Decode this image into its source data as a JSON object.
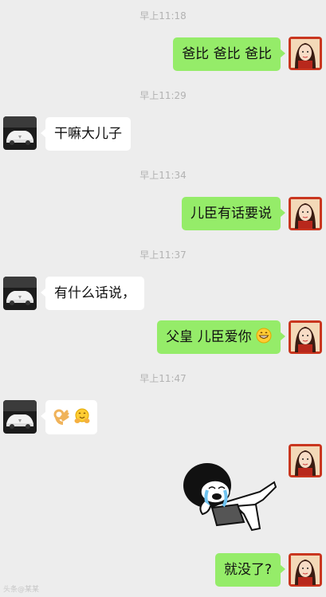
{
  "messages": [
    {
      "time": "早上11:18",
      "side": "out",
      "text": "爸比 爸比  爸比"
    },
    {
      "time": "早上11:29",
      "side": "in",
      "text": "干嘛大儿子"
    },
    {
      "time": "早上11:34",
      "side": "out",
      "text": "儿臣有话要说"
    },
    {
      "time": "早上11:37",
      "side": "in",
      "text": "有什么话说，"
    },
    {
      "side": "out",
      "text": "父皇 儿臣爱你",
      "emoji": "grinning-face-icon"
    },
    {
      "time": "早上11:47",
      "side": "in",
      "text": "",
      "emoji": "ok-hand-icon + hugging-face-icon"
    },
    {
      "side": "out",
      "sticker": "crying-cartoon-sticker"
    },
    {
      "side": "out",
      "text": "就没了?"
    }
  ],
  "avatars": {
    "me": "girl-avatar",
    "them": "car-avatar"
  },
  "watermark": "头条@某某",
  "colors": {
    "out_bubble": "#95ec69",
    "in_bubble": "#ffffff",
    "background": "#ededed"
  }
}
